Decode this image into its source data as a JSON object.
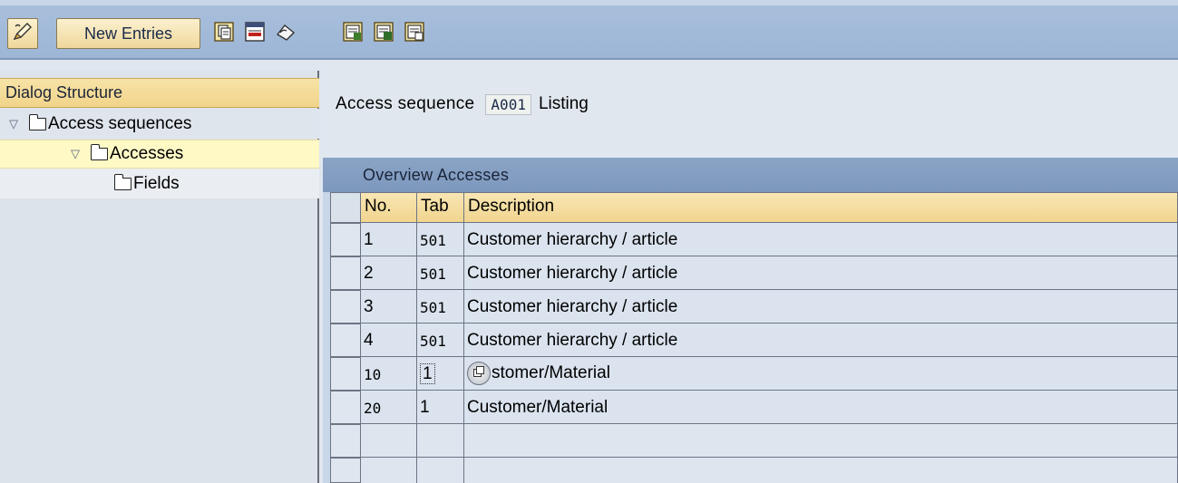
{
  "toolbar": {
    "new_entries_label": "New Entries",
    "icons": [
      "edit-pencil-icon",
      "copy-icon",
      "delete-icon",
      "undo-icon",
      "select-all-icon",
      "select-block-icon",
      "deselect-all-icon"
    ]
  },
  "dialog_structure": {
    "title": "Dialog Structure",
    "items": [
      {
        "label": "Access sequences",
        "expanded": true,
        "level": 0
      },
      {
        "label": "Accesses",
        "expanded": true,
        "level": 1,
        "selected": true
      },
      {
        "label": "Fields",
        "expanded": false,
        "level": 2
      }
    ]
  },
  "header": {
    "access_sequence_label": "Access sequence",
    "access_sequence_code": "A001",
    "access_sequence_desc": "Listing"
  },
  "table": {
    "title": "Overview Accesses",
    "columns": [
      "No.",
      "Tab",
      "Description"
    ],
    "rows": [
      {
        "no": "1",
        "tab": "501",
        "desc": "Customer hierarchy / article"
      },
      {
        "no": "2",
        "tab": "501",
        "desc": "Customer hierarchy / article"
      },
      {
        "no": "3",
        "tab": "501",
        "desc": "Customer hierarchy / article"
      },
      {
        "no": "4",
        "tab": "501",
        "desc": "Customer hierarchy / article"
      },
      {
        "no": "10",
        "tab": "1",
        "desc": "stomer/Material"
      },
      {
        "no": "20",
        "tab": "1",
        "desc": "Customer/Material"
      }
    ]
  },
  "colors": {
    "toolbar_bg": "#9db6d6",
    "button_bg": "#efd79b",
    "header_bg": "#f1d58f",
    "table_title_bg": "#7d98bd",
    "selected_tree_bg": "#fff9c6"
  }
}
